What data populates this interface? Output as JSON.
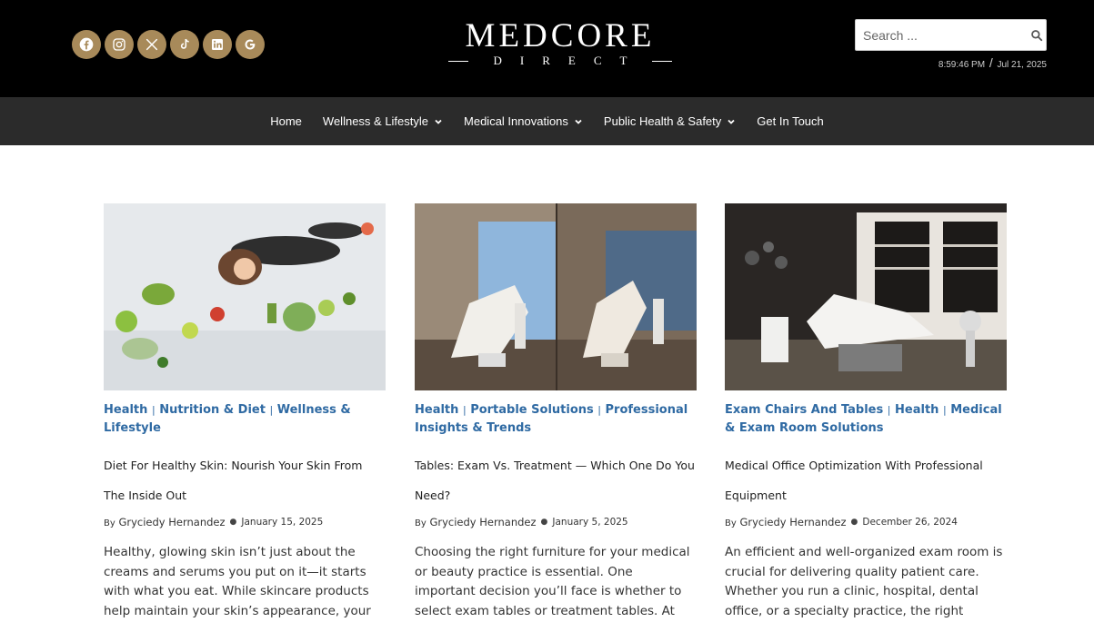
{
  "header": {
    "socials": [
      {
        "name": "facebook-icon"
      },
      {
        "name": "instagram-icon"
      },
      {
        "name": "x-icon"
      },
      {
        "name": "tiktok-icon"
      },
      {
        "name": "linkedin-icon"
      },
      {
        "name": "google-icon"
      }
    ],
    "social_color": "#a88a5a",
    "logo": {
      "main": "MEDCORE",
      "sub": "DIRECT"
    },
    "search": {
      "placeholder": "Search ..."
    },
    "time": "8:59:46 PM",
    "date": "Jul 21, 2025"
  },
  "nav": {
    "items": [
      {
        "label": "Home"
      },
      {
        "label": "Wellness & Lifestyle"
      },
      {
        "label": "Medical Innovations"
      },
      {
        "label": "Public Health & Safety"
      },
      {
        "label": "Get In Touch"
      }
    ]
  },
  "accent_color": "#2f6aa3",
  "posts": [
    {
      "categories": [
        "Health",
        "Nutrition & Diet",
        "Wellness & Lifestyle"
      ],
      "title": "Diet For Healthy Skin: Nourish Your Skin From The Inside Out",
      "by": "By",
      "author": "Gryciedy Hernandez",
      "date": "January 15, 2025",
      "excerpt": "Healthy, glowing skin isn’t just about the creams and serums you put on it—it starts with what you eat. While skincare products help maintain your skin’s appearance, your"
    },
    {
      "categories": [
        "Health",
        "Portable Solutions",
        "Professional Insights & Trends"
      ],
      "title": "Tables: Exam Vs. Treatment — Which One Do You Need?",
      "by": "By",
      "author": "Gryciedy Hernandez",
      "date": "January 5, 2025",
      "excerpt": "Choosing the right furniture for your medical or beauty practice is essential. One important decision you’ll face is whether to select exam tables or treatment tables. At"
    },
    {
      "categories": [
        "Exam Chairs And Tables",
        "Health",
        "Medical & Exam Room Solutions"
      ],
      "title": "Medical Office Optimization With Professional Equipment",
      "by": "By",
      "author": "Gryciedy Hernandez",
      "date": "December 26, 2024",
      "excerpt": "An efficient and well-organized exam room is crucial for delivering quality patient care. Whether you run a clinic, hospital, dental office, or a specialty practice, the right"
    }
  ]
}
